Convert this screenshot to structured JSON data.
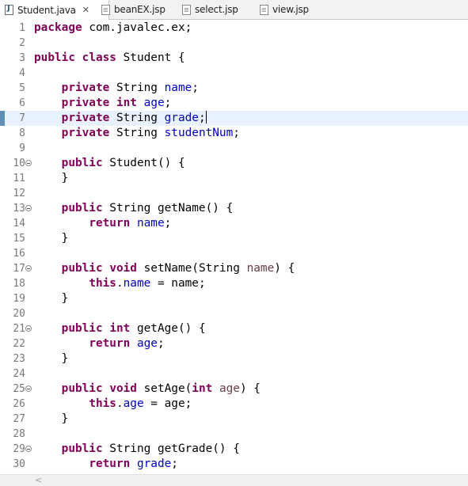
{
  "tabs": [
    {
      "label": "Student.java",
      "icon": "java-file-icon",
      "active": true,
      "close": "✕"
    },
    {
      "label": "beanEX.jsp",
      "icon": "jsp-file-icon",
      "active": false
    },
    {
      "label": "select.jsp",
      "icon": "jsp-file-icon",
      "active": false
    },
    {
      "label": "view.jsp",
      "icon": "jsp-file-icon",
      "active": false
    }
  ],
  "editor": {
    "current_line": 7,
    "lines": [
      {
        "n": "1",
        "t": "package com.javalec.ex;"
      },
      {
        "n": "2",
        "t": ""
      },
      {
        "n": "3",
        "t": "public class Student {"
      },
      {
        "n": "4",
        "t": ""
      },
      {
        "n": "5",
        "t": "    private String name;"
      },
      {
        "n": "6",
        "t": "    private int age;"
      },
      {
        "n": "7",
        "t": "    private String grade;"
      },
      {
        "n": "8",
        "t": "    private String studentNum;"
      },
      {
        "n": "9",
        "t": ""
      },
      {
        "n": "10",
        "t": "    public Student() {"
      },
      {
        "n": "11",
        "t": "    }"
      },
      {
        "n": "12",
        "t": ""
      },
      {
        "n": "13",
        "t": "    public String getName() {"
      },
      {
        "n": "14",
        "t": "        return name;"
      },
      {
        "n": "15",
        "t": "    }"
      },
      {
        "n": "16",
        "t": ""
      },
      {
        "n": "17",
        "t": "    public void setName(String name) {"
      },
      {
        "n": "18",
        "t": "        this.name = name;"
      },
      {
        "n": "19",
        "t": "    }"
      },
      {
        "n": "20",
        "t": ""
      },
      {
        "n": "21",
        "t": "    public int getAge() {"
      },
      {
        "n": "22",
        "t": "        return age;"
      },
      {
        "n": "23",
        "t": "    }"
      },
      {
        "n": "24",
        "t": ""
      },
      {
        "n": "25",
        "t": "    public void setAge(int age) {"
      },
      {
        "n": "26",
        "t": "        this.age = age;"
      },
      {
        "n": "27",
        "t": "    }"
      },
      {
        "n": "28",
        "t": ""
      },
      {
        "n": "29",
        "t": "    public String getGrade() {"
      },
      {
        "n": "30",
        "t": "        return grade;"
      }
    ],
    "fold_lines": [
      10,
      13,
      17,
      21,
      25,
      29
    ],
    "changed_lines": [
      7
    ]
  },
  "scrollbar": {
    "left_arrow": "<"
  },
  "colors": {
    "keyword": "#7f0055",
    "field": "#0000c0",
    "parameter": "#6a3e3e",
    "current_line": "#e8f2fe"
  }
}
